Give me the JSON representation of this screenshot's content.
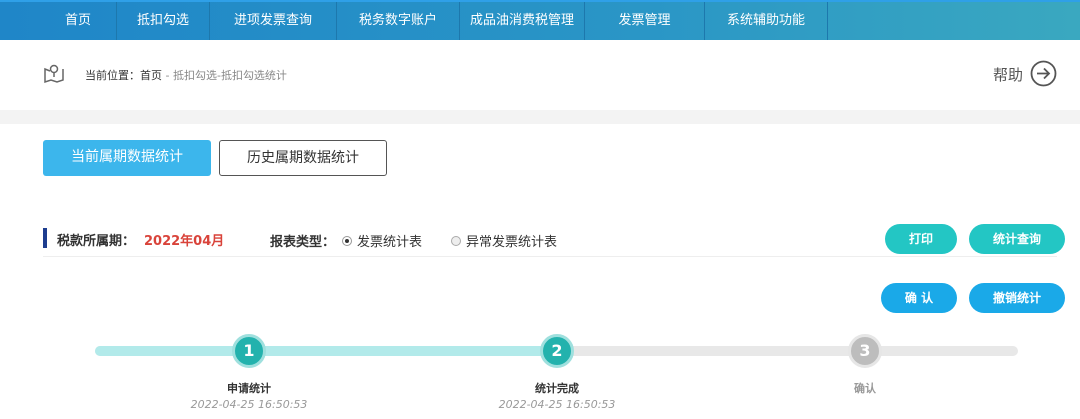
{
  "nav": [
    "首页",
    "抵扣勾选",
    "进项发票查询",
    "税务数字账户",
    "成品油消费税管理",
    "发票管理",
    "系统辅助功能"
  ],
  "breadcrumb": {
    "prefix": "当前位置：",
    "home": "首页",
    "sep": " - ",
    "path": "抵扣勾选-抵扣勾选统计"
  },
  "help": "帮助",
  "tabs": {
    "current": "当前属期数据统计",
    "history": "历史属期数据统计"
  },
  "period": {
    "label": "税款所属期：",
    "value": "2022年04月"
  },
  "report": {
    "label": "报表类型：",
    "options": [
      "发票统计表",
      "异常发票统计表"
    ],
    "selected": 0
  },
  "buttons": {
    "print": "打印",
    "query": "统计查询",
    "confirm": "确 认",
    "cancel": "撤销统计"
  },
  "steps": [
    {
      "num": "1",
      "label": "申请统计",
      "time": "2022-04-25 16:50:53"
    },
    {
      "num": "2",
      "label": "统计完成",
      "time": "2022-04-25 16:50:53"
    },
    {
      "num": "3",
      "label": "确认",
      "time": ""
    }
  ],
  "progress": 0.5,
  "colors": {
    "accent": "#1aa9e8",
    "teal": "#23bfc2",
    "red": "#d9433a"
  }
}
